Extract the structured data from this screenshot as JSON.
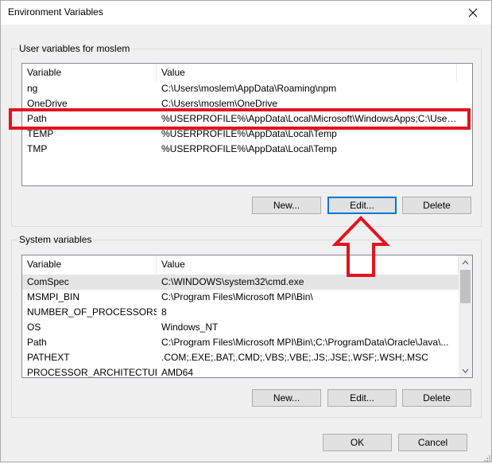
{
  "window": {
    "title": "Environment Variables"
  },
  "user_vars": {
    "group_label": "User variables for moslem",
    "col_variable": "Variable",
    "col_value": "Value",
    "rows": [
      {
        "name": "ng",
        "value": "C:\\Users\\moslem\\AppData\\Roaming\\npm"
      },
      {
        "name": "OneDrive",
        "value": "C:\\Users\\moslem\\OneDrive"
      },
      {
        "name": "Path",
        "value": "%USERPROFILE%\\AppData\\Local\\Microsoft\\WindowsApps;C:\\User..."
      },
      {
        "name": "TEMP",
        "value": "%USERPROFILE%\\AppData\\Local\\Temp"
      },
      {
        "name": "TMP",
        "value": "%USERPROFILE%\\AppData\\Local\\Temp"
      }
    ],
    "new_label": "New...",
    "edit_label": "Edit...",
    "delete_label": "Delete"
  },
  "system_vars": {
    "group_label": "System variables",
    "col_variable": "Variable",
    "col_value": "Value",
    "rows": [
      {
        "name": "ComSpec",
        "value": "C:\\WINDOWS\\system32\\cmd.exe"
      },
      {
        "name": "MSMPI_BIN",
        "value": "C:\\Program Files\\Microsoft MPI\\Bin\\"
      },
      {
        "name": "NUMBER_OF_PROCESSORS",
        "value": "8"
      },
      {
        "name": "OS",
        "value": "Windows_NT"
      },
      {
        "name": "Path",
        "value": "C:\\Program Files\\Microsoft MPI\\Bin\\;C:\\ProgramData\\Oracle\\Java\\..."
      },
      {
        "name": "PATHEXT",
        "value": ".COM;.EXE;.BAT;.CMD;.VBS;.VBE;.JS;.JSE;.WSF;.WSH;.MSC"
      },
      {
        "name": "PROCESSOR_ARCHITECTURE",
        "value": "AMD64"
      }
    ],
    "new_label": "New...",
    "edit_label": "Edit...",
    "delete_label": "Delete"
  },
  "footer": {
    "ok_label": "OK",
    "cancel_label": "Cancel"
  },
  "colors": {
    "annotation": "#e3131f",
    "focus": "#0078d7",
    "selected_row": "#e5e5e5"
  }
}
